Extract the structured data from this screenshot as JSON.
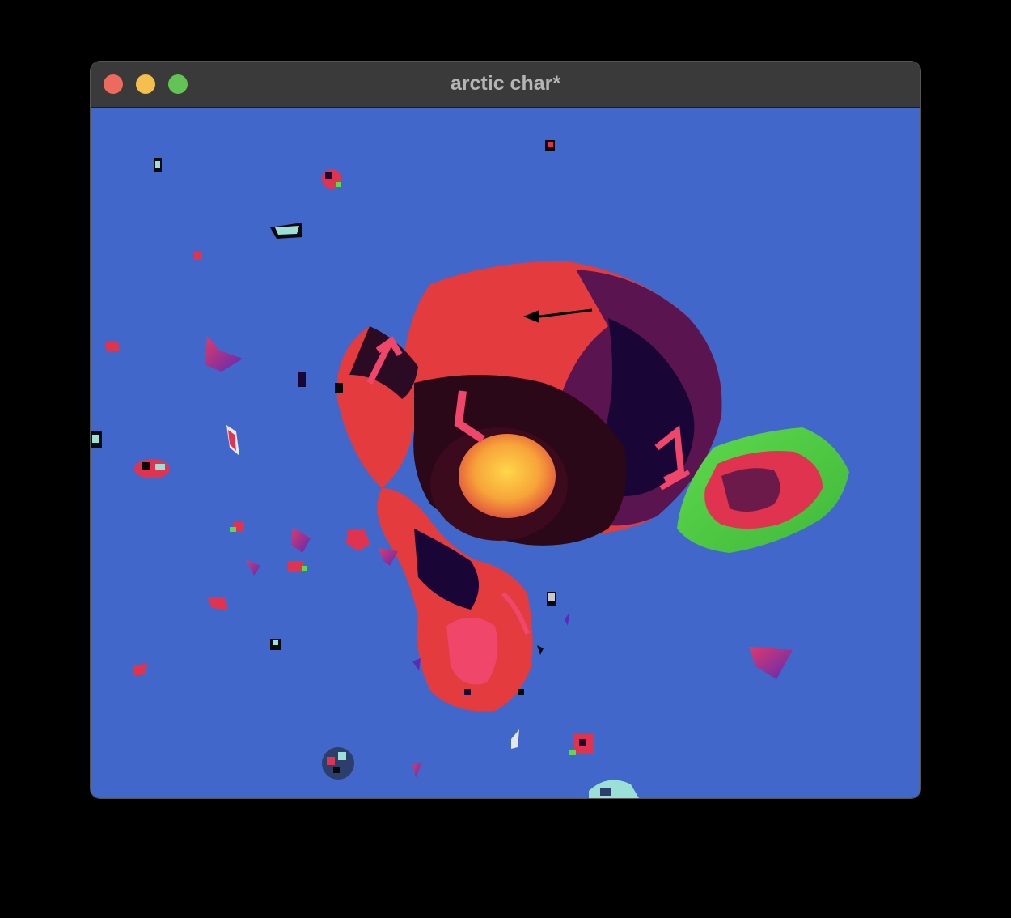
{
  "window": {
    "title": "arctic char*",
    "controls": {
      "close": "close-icon",
      "minimize": "minimize-icon",
      "zoom": "zoom-icon"
    }
  },
  "viewport": {
    "background_color": "#4267cb",
    "scene": "3d-monkey-head-with-floating-debris"
  },
  "colors": {
    "close": "#ed6a5e",
    "minimize": "#f5bf4f",
    "zoom": "#61c454",
    "titlebar": "#3a3a3a",
    "title_text": "#b5b5b5"
  }
}
